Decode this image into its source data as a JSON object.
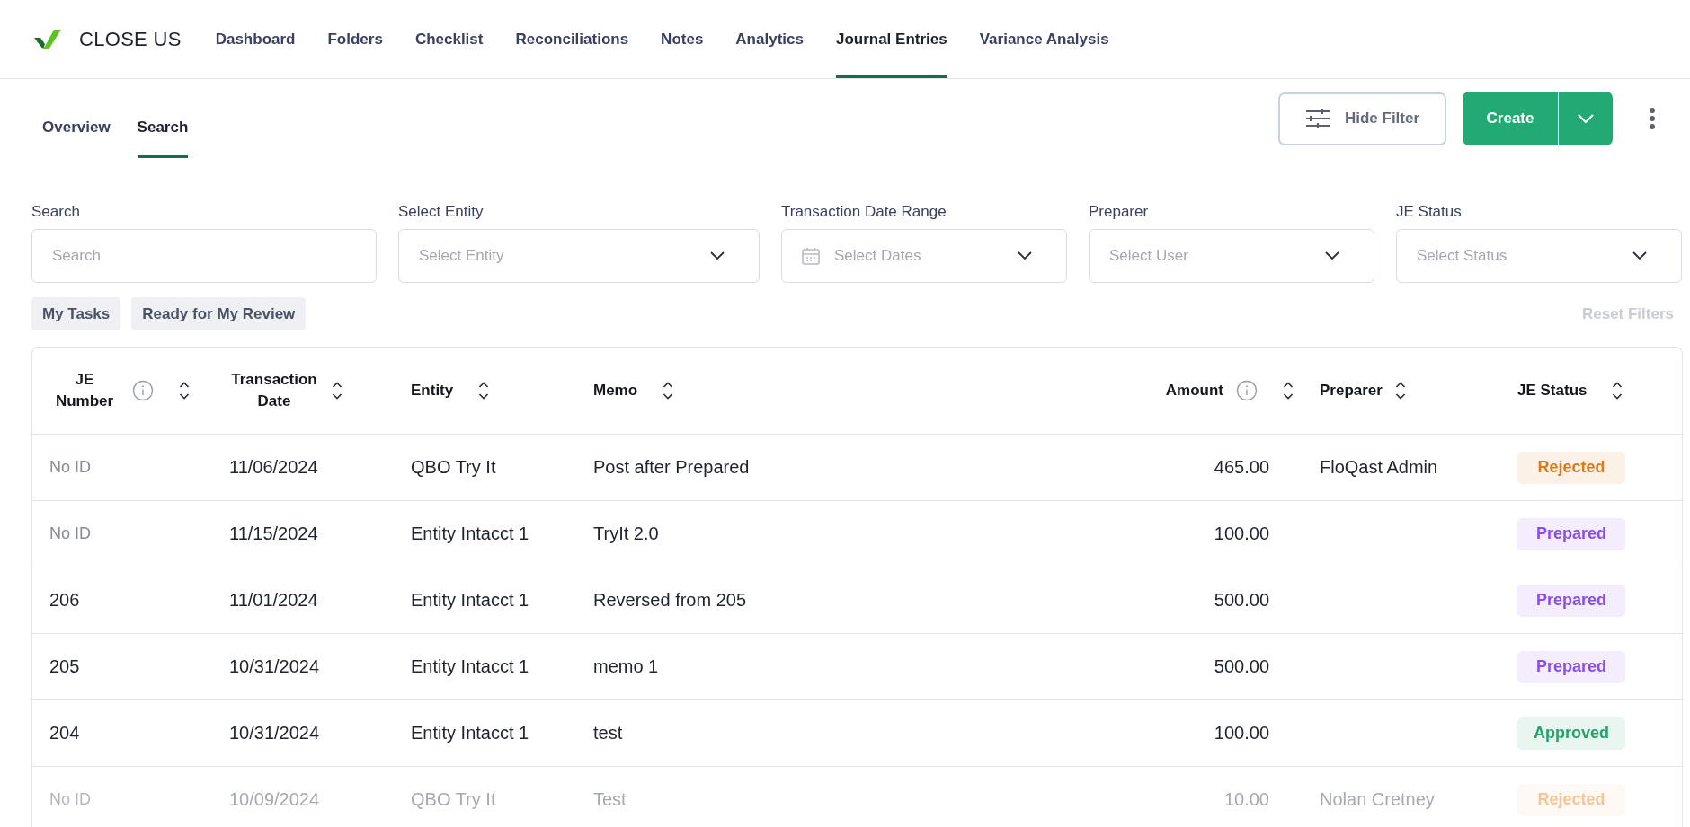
{
  "app": {
    "name": "CLOSE US"
  },
  "nav": [
    {
      "label": "Dashboard",
      "selected": false
    },
    {
      "label": "Folders",
      "selected": false
    },
    {
      "label": "Checklist",
      "selected": false
    },
    {
      "label": "Reconciliations",
      "selected": false
    },
    {
      "label": "Notes",
      "selected": false
    },
    {
      "label": "Analytics",
      "selected": false
    },
    {
      "label": "Journal Entries",
      "selected": true
    },
    {
      "label": "Variance Analysis",
      "selected": false
    }
  ],
  "subtabs": [
    {
      "label": "Overview",
      "selected": false
    },
    {
      "label": "Search",
      "selected": true
    }
  ],
  "actions": {
    "hide_filter": "Hide Filter",
    "create": "Create"
  },
  "filters": [
    {
      "kind": "text",
      "label": "Search",
      "placeholder": "Search"
    },
    {
      "kind": "select",
      "label": "Select Entity",
      "placeholder": "Select Entity"
    },
    {
      "kind": "date",
      "label": "Transaction Date Range",
      "placeholder": "Select Dates"
    },
    {
      "kind": "select",
      "label": "Preparer",
      "placeholder": "Select User"
    },
    {
      "kind": "select",
      "label": "JE Status",
      "placeholder": "Select Status"
    }
  ],
  "quick_filters": [
    "My Tasks",
    "Ready for My Review"
  ],
  "reset_filters": {
    "label": "Reset Filters",
    "disabled": true
  },
  "table": {
    "columns": [
      {
        "label": "JE Number",
        "info": true,
        "kind": "text"
      },
      {
        "label": "Transaction Date",
        "info": false,
        "kind": "text"
      },
      {
        "label": "Entity",
        "info": false,
        "kind": "text"
      },
      {
        "label": "Memo",
        "info": false,
        "kind": "text"
      },
      {
        "label": "Amount",
        "info": true,
        "kind": "number"
      },
      {
        "label": "Preparer",
        "info": false,
        "kind": "text"
      },
      {
        "label": "JE Status",
        "info": false,
        "kind": "text"
      }
    ],
    "rows": [
      {
        "je_number": "No ID",
        "has_id": false,
        "date": "11/06/2024",
        "entity": "QBO Try It",
        "memo": "Post after Prepared",
        "amount": "465.00",
        "preparer": "FloQast Admin",
        "status": "Rejected",
        "color": "#e07a10",
        "faded": false
      },
      {
        "je_number": "No ID",
        "has_id": false,
        "date": "11/15/2024",
        "entity": "Entity Intacct 1",
        "memo": "TryIt 2.0",
        "amount": "100.00",
        "status": "Prepared",
        "color": "#8a4cf0",
        "faded": false
      },
      {
        "je_number": "206",
        "has_id": true,
        "date": "11/01/2024",
        "entity": "Entity Intacct 1",
        "memo": "Reversed from 205",
        "amount": "500.00",
        "status": "Prepared",
        "color": "#8a4cf0",
        "faded": false
      },
      {
        "je_number": "205",
        "has_id": true,
        "date": "10/31/2024",
        "entity": "Entity Intacct 1",
        "memo": "memo 1",
        "amount": "500.00",
        "status": "Prepared",
        "color": "#8a4cf0",
        "faded": false
      },
      {
        "je_number": "204",
        "has_id": true,
        "date": "10/31/2024",
        "entity": "Entity Intacct 1",
        "memo": "test",
        "amount": "100.00",
        "status": "Approved",
        "color": "#23a36b",
        "faded": false
      },
      {
        "je_number": "No ID",
        "has_id": false,
        "date": "10/09/2024",
        "entity": "QBO Try It",
        "memo": "Test",
        "amount": "10.00",
        "preparer": "Nolan Cretney",
        "status": "Rejected",
        "color": "#f3c596",
        "faded": true
      }
    ]
  }
}
